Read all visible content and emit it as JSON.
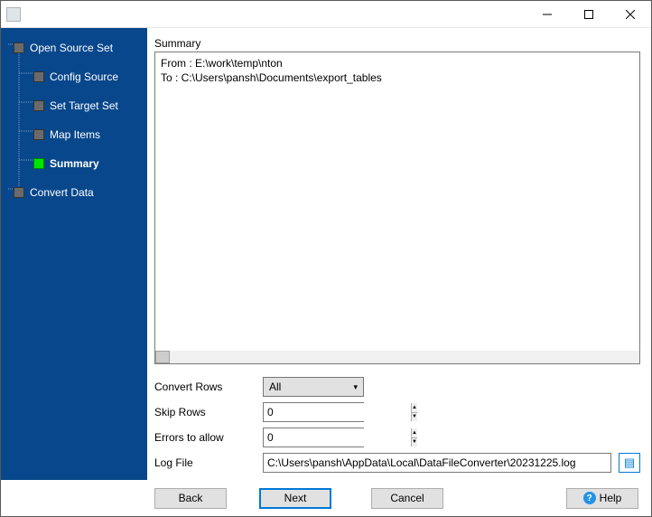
{
  "window": {
    "title": ""
  },
  "sidebar": {
    "items": [
      {
        "label": "Open Source Set",
        "level": "top",
        "current": false
      },
      {
        "label": "Config Source",
        "level": "child",
        "current": false
      },
      {
        "label": "Set Target Set",
        "level": "child",
        "current": false
      },
      {
        "label": "Map Items",
        "level": "child",
        "current": false
      },
      {
        "label": "Summary",
        "level": "child",
        "current": true
      },
      {
        "label": "Convert Data",
        "level": "top",
        "current": false
      }
    ]
  },
  "main": {
    "section_title": "Summary",
    "summary_lines": {
      "line1": "From : E:\\work\\temp\\nton",
      "line2": "To : C:\\Users\\pansh\\Documents\\export_tables"
    },
    "controls": {
      "convert_rows_label": "Convert Rows",
      "convert_rows_value": "All",
      "skip_rows_label": "Skip Rows",
      "skip_rows_value": "0",
      "errors_label": "Errors to allow",
      "errors_value": "0",
      "logfile_label": "Log File",
      "logfile_value": "C:\\Users\\pansh\\AppData\\Local\\DataFileConverter\\20231225.log"
    }
  },
  "buttons": {
    "back": "Back",
    "next": "Next",
    "cancel": "Cancel",
    "help": "Help"
  }
}
